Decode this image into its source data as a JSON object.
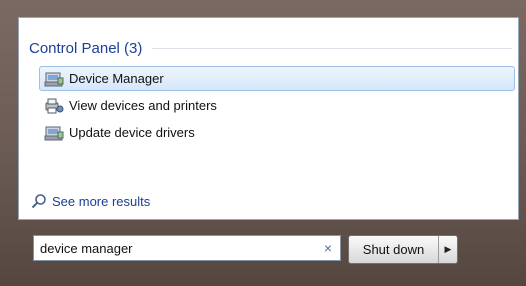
{
  "section": {
    "title": "Control Panel (3)"
  },
  "results": [
    {
      "label": "Device Manager",
      "icon": "device-manager-icon",
      "selected": true
    },
    {
      "label": "View devices and printers",
      "icon": "devices-printers-icon",
      "selected": false
    },
    {
      "label": "Update device drivers",
      "icon": "device-manager-icon",
      "selected": false
    }
  ],
  "see_more": {
    "label": "See more results",
    "icon": "search-icon"
  },
  "search": {
    "value": "device manager",
    "clear_glyph": "×"
  },
  "shutdown": {
    "label": "Shut down",
    "arrow_glyph": "▶"
  },
  "colors": {
    "accent": "#1c3f94",
    "selection": "#d5e7fb"
  }
}
